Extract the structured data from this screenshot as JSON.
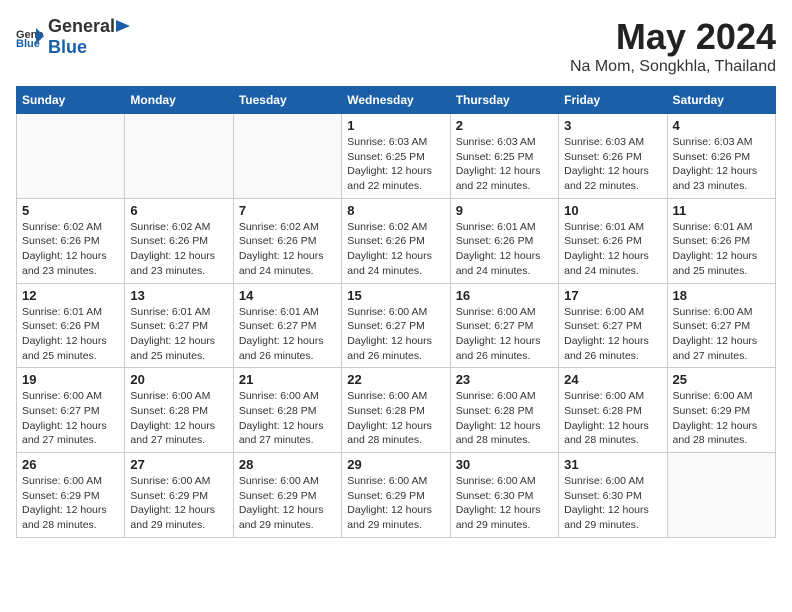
{
  "header": {
    "logo_general": "General",
    "logo_blue": "Blue",
    "title": "May 2024",
    "subtitle": "Na Mom, Songkhla, Thailand"
  },
  "calendar": {
    "days_of_week": [
      "Sunday",
      "Monday",
      "Tuesday",
      "Wednesday",
      "Thursday",
      "Friday",
      "Saturday"
    ],
    "weeks": [
      [
        {
          "day": "",
          "info": ""
        },
        {
          "day": "",
          "info": ""
        },
        {
          "day": "",
          "info": ""
        },
        {
          "day": "1",
          "info": "Sunrise: 6:03 AM\nSunset: 6:25 PM\nDaylight: 12 hours\nand 22 minutes."
        },
        {
          "day": "2",
          "info": "Sunrise: 6:03 AM\nSunset: 6:25 PM\nDaylight: 12 hours\nand 22 minutes."
        },
        {
          "day": "3",
          "info": "Sunrise: 6:03 AM\nSunset: 6:26 PM\nDaylight: 12 hours\nand 22 minutes."
        },
        {
          "day": "4",
          "info": "Sunrise: 6:03 AM\nSunset: 6:26 PM\nDaylight: 12 hours\nand 23 minutes."
        }
      ],
      [
        {
          "day": "5",
          "info": "Sunrise: 6:02 AM\nSunset: 6:26 PM\nDaylight: 12 hours\nand 23 minutes."
        },
        {
          "day": "6",
          "info": "Sunrise: 6:02 AM\nSunset: 6:26 PM\nDaylight: 12 hours\nand 23 minutes."
        },
        {
          "day": "7",
          "info": "Sunrise: 6:02 AM\nSunset: 6:26 PM\nDaylight: 12 hours\nand 24 minutes."
        },
        {
          "day": "8",
          "info": "Sunrise: 6:02 AM\nSunset: 6:26 PM\nDaylight: 12 hours\nand 24 minutes."
        },
        {
          "day": "9",
          "info": "Sunrise: 6:01 AM\nSunset: 6:26 PM\nDaylight: 12 hours\nand 24 minutes."
        },
        {
          "day": "10",
          "info": "Sunrise: 6:01 AM\nSunset: 6:26 PM\nDaylight: 12 hours\nand 24 minutes."
        },
        {
          "day": "11",
          "info": "Sunrise: 6:01 AM\nSunset: 6:26 PM\nDaylight: 12 hours\nand 25 minutes."
        }
      ],
      [
        {
          "day": "12",
          "info": "Sunrise: 6:01 AM\nSunset: 6:26 PM\nDaylight: 12 hours\nand 25 minutes."
        },
        {
          "day": "13",
          "info": "Sunrise: 6:01 AM\nSunset: 6:27 PM\nDaylight: 12 hours\nand 25 minutes."
        },
        {
          "day": "14",
          "info": "Sunrise: 6:01 AM\nSunset: 6:27 PM\nDaylight: 12 hours\nand 26 minutes."
        },
        {
          "day": "15",
          "info": "Sunrise: 6:00 AM\nSunset: 6:27 PM\nDaylight: 12 hours\nand 26 minutes."
        },
        {
          "day": "16",
          "info": "Sunrise: 6:00 AM\nSunset: 6:27 PM\nDaylight: 12 hours\nand 26 minutes."
        },
        {
          "day": "17",
          "info": "Sunrise: 6:00 AM\nSunset: 6:27 PM\nDaylight: 12 hours\nand 26 minutes."
        },
        {
          "day": "18",
          "info": "Sunrise: 6:00 AM\nSunset: 6:27 PM\nDaylight: 12 hours\nand 27 minutes."
        }
      ],
      [
        {
          "day": "19",
          "info": "Sunrise: 6:00 AM\nSunset: 6:27 PM\nDaylight: 12 hours\nand 27 minutes."
        },
        {
          "day": "20",
          "info": "Sunrise: 6:00 AM\nSunset: 6:28 PM\nDaylight: 12 hours\nand 27 minutes."
        },
        {
          "day": "21",
          "info": "Sunrise: 6:00 AM\nSunset: 6:28 PM\nDaylight: 12 hours\nand 27 minutes."
        },
        {
          "day": "22",
          "info": "Sunrise: 6:00 AM\nSunset: 6:28 PM\nDaylight: 12 hours\nand 28 minutes."
        },
        {
          "day": "23",
          "info": "Sunrise: 6:00 AM\nSunset: 6:28 PM\nDaylight: 12 hours\nand 28 minutes."
        },
        {
          "day": "24",
          "info": "Sunrise: 6:00 AM\nSunset: 6:28 PM\nDaylight: 12 hours\nand 28 minutes."
        },
        {
          "day": "25",
          "info": "Sunrise: 6:00 AM\nSunset: 6:29 PM\nDaylight: 12 hours\nand 28 minutes."
        }
      ],
      [
        {
          "day": "26",
          "info": "Sunrise: 6:00 AM\nSunset: 6:29 PM\nDaylight: 12 hours\nand 28 minutes."
        },
        {
          "day": "27",
          "info": "Sunrise: 6:00 AM\nSunset: 6:29 PM\nDaylight: 12 hours\nand 29 minutes."
        },
        {
          "day": "28",
          "info": "Sunrise: 6:00 AM\nSunset: 6:29 PM\nDaylight: 12 hours\nand 29 minutes."
        },
        {
          "day": "29",
          "info": "Sunrise: 6:00 AM\nSunset: 6:29 PM\nDaylight: 12 hours\nand 29 minutes."
        },
        {
          "day": "30",
          "info": "Sunrise: 6:00 AM\nSunset: 6:30 PM\nDaylight: 12 hours\nand 29 minutes."
        },
        {
          "day": "31",
          "info": "Sunrise: 6:00 AM\nSunset: 6:30 PM\nDaylight: 12 hours\nand 29 minutes."
        },
        {
          "day": "",
          "info": ""
        }
      ]
    ]
  }
}
